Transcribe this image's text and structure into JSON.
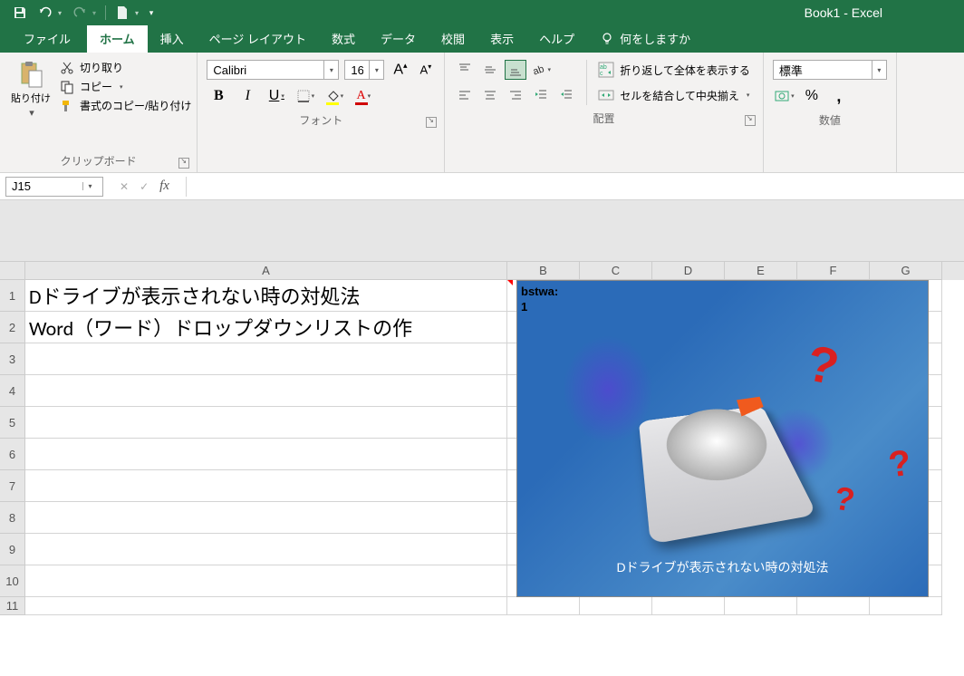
{
  "title": "Book1  -  Excel",
  "qat": {
    "save": "save-icon",
    "undo": "undo-icon",
    "redo": "redo-icon",
    "new": "new-icon"
  },
  "tabs": {
    "file": "ファイル",
    "home": "ホーム",
    "insert": "挿入",
    "pagelayout": "ページ レイアウト",
    "formulas": "数式",
    "data": "データ",
    "review": "校閲",
    "view": "表示",
    "help": "ヘルプ",
    "tellme": "何をしますか"
  },
  "clipboard": {
    "paste": "貼り付け",
    "cut": "切り取り",
    "copy": "コピー",
    "formatpainter": "書式のコピー/貼り付け",
    "label": "クリップボード"
  },
  "font": {
    "name": "Calibri",
    "size": "16",
    "bold": "B",
    "italic": "I",
    "underline": "U",
    "label": "フォント"
  },
  "alignment": {
    "wrap": "折り返して全体を表示する",
    "merge": "セルを結合して中央揃え",
    "label": "配置"
  },
  "number": {
    "format": "標準",
    "label": "数値"
  },
  "namebox": "J15",
  "formula": "",
  "columns": [
    "A",
    "B",
    "C",
    "D",
    "E",
    "F",
    "G"
  ],
  "rows": [
    "1",
    "2",
    "3",
    "4",
    "5",
    "6",
    "7",
    "8",
    "9",
    "10",
    "11"
  ],
  "cells": {
    "A1": "Dドライブが表示されない時の対処法",
    "A2": "Word（ワード）ドロップダウンリストの作"
  },
  "overlay": {
    "tag": "bstwa:",
    "num": "1",
    "caption": "Dドライブが表示されない時の対処法"
  }
}
